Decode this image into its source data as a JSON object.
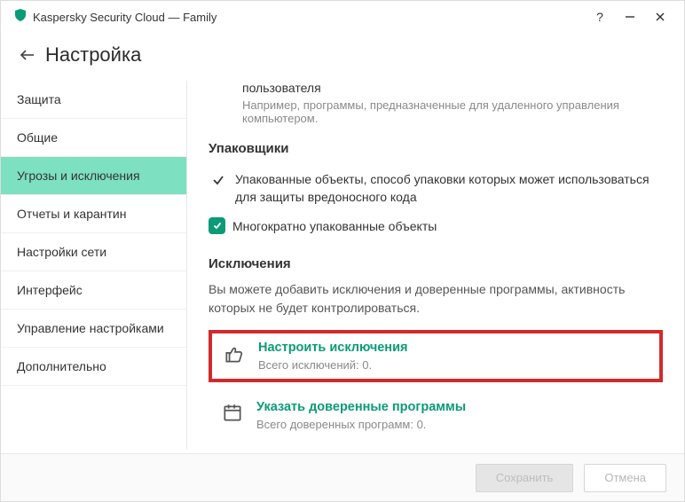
{
  "titlebar": {
    "app_title": "Kaspersky Security Cloud — Family"
  },
  "header": {
    "title": "Настройка"
  },
  "sidebar": {
    "items": [
      {
        "label": "Защита"
      },
      {
        "label": "Общие"
      },
      {
        "label": "Угрозы и исключения"
      },
      {
        "label": "Отчеты и карантин"
      },
      {
        "label": "Настройки сети"
      },
      {
        "label": "Интерфейс"
      },
      {
        "label": "Управление настройками"
      },
      {
        "label": "Дополнительно"
      }
    ]
  },
  "content": {
    "user_section": {
      "item": "пользователя",
      "desc": "Например, программы, предназначенные для удаленного управления компьютером."
    },
    "packers": {
      "heading": "Упаковщики",
      "row1": "Упакованные объекты, способ упаковки которых может использоваться для защиты вредоносного кода",
      "row2": "Многократно упакованные объекты"
    },
    "exclusions": {
      "heading": "Исключения",
      "desc": "Вы можете добавить исключения и доверенные программы, активность которых не будет контролироваться.",
      "configure": {
        "label": "Настроить исключения",
        "meta": "Всего исключений: 0."
      },
      "trusted": {
        "label": "Указать доверенные программы",
        "meta": "Всего доверенных программ: 0."
      }
    }
  },
  "footer": {
    "save": "Сохранить",
    "cancel": "Отмена"
  }
}
